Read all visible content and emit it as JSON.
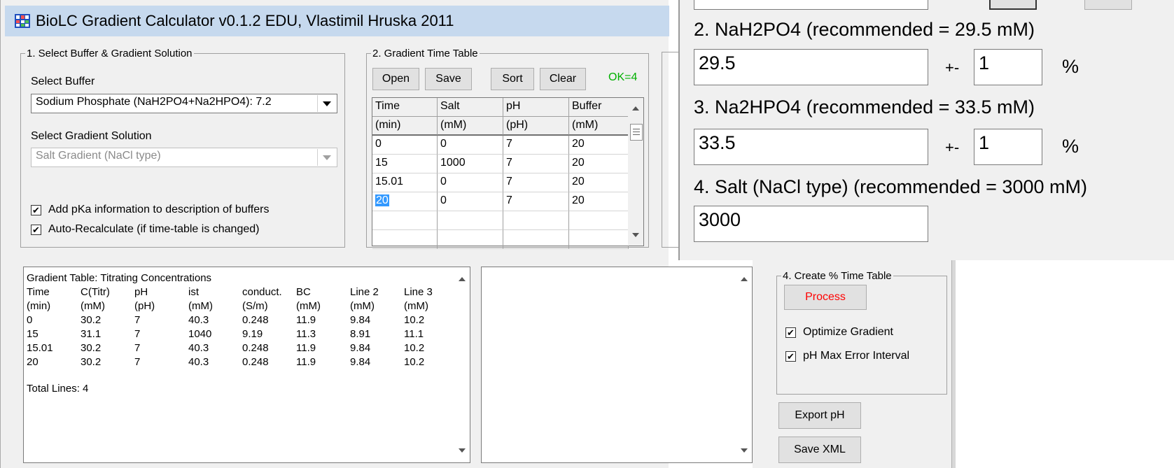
{
  "window": {
    "title": "BioLC Gradient Calculator v0.1.2 EDU, Vlastimil Hruska 2011",
    "title_bar_color": "#c6d9ee"
  },
  "buffer_group": {
    "legend": "1. Select Buffer & Gradient Solution",
    "select_buffer_label": "Select Buffer",
    "buffer_value": "Sodium Phosphate (NaH2PO4+Na2HPO4): 7.2",
    "select_gradient_label": "Select Gradient Solution",
    "gradient_value": "Salt Gradient (NaCl type)",
    "add_pka_label": "Add pKa information to description of buffers",
    "add_pka_checked": true,
    "auto_recalc_label": "Auto-Recalculate  (if time-table is changed)",
    "auto_recalc_checked": true
  },
  "time_table_group": {
    "legend": "2. Gradient Time Table",
    "open_label": "Open",
    "save_label": "Save",
    "sort_label": "Sort",
    "clear_label": "Clear",
    "status": "OK=4",
    "status_color": "#00b000",
    "headers": [
      "Time",
      "Salt",
      "pH",
      "Buffer"
    ],
    "units": [
      "(min)",
      "(mM)",
      "(pH)",
      "(mM)"
    ],
    "rows": [
      [
        "0",
        "0",
        "7",
        "20"
      ],
      [
        "15",
        "1000",
        "7",
        "20"
      ],
      [
        "15.01",
        "0",
        "7",
        "20"
      ],
      [
        "20",
        "0",
        "7",
        "20"
      ]
    ]
  },
  "results": {
    "title": "Gradient Table: Titrating Concentrations",
    "headers": [
      "Time",
      "C(Titr)",
      "pH",
      "ist",
      "conduct.",
      "BC",
      "Line 2",
      "Line 3"
    ],
    "units": [
      "(min)",
      "(mM)",
      "(pH)",
      "(mM)",
      "(S/m)",
      "(mM)",
      "(mM)",
      "(mM)"
    ],
    "rows": [
      [
        "0",
        "30.2",
        "7",
        "40.3",
        "0.248",
        "11.9",
        "9.84",
        "10.2"
      ],
      [
        "15",
        "31.1",
        "7",
        "1040",
        "9.19",
        "11.3",
        "8.91",
        "11.1"
      ],
      [
        "15.01",
        "30.2",
        "7",
        "40.3",
        "0.248",
        "11.9",
        "9.84",
        "10.2"
      ],
      [
        "20",
        "30.2",
        "7",
        "40.3",
        "0.248",
        "11.9",
        "9.84",
        "10.2"
      ]
    ],
    "total_lines": "Total Lines: 4"
  },
  "create_group": {
    "legend": "4. Create % Time Table",
    "process_label": "Process",
    "process_color": "#ff0000",
    "optimize_label": "Optimize Gradient",
    "optimize_checked": true,
    "ph_error_label": "pH Max Error Interval",
    "ph_error_checked": true,
    "export_ph_label": "Export pH",
    "save_xml_label": "Save XML"
  },
  "settings": {
    "nah2po4_label": "2. NaH2PO4 (recommended = 29.5 mM)",
    "nah2po4_value": "29.5",
    "nah2po4_tol": "1",
    "na2hpo4_label": "3. Na2HPO4 (recommended = 33.5 mM)",
    "na2hpo4_value": "33.5",
    "na2hpo4_tol": "1",
    "plusminus": "+-",
    "percent": "%",
    "salt_label": "4. Salt (NaCl type) (recommended = 3000 mM)",
    "salt_value": "3000"
  }
}
